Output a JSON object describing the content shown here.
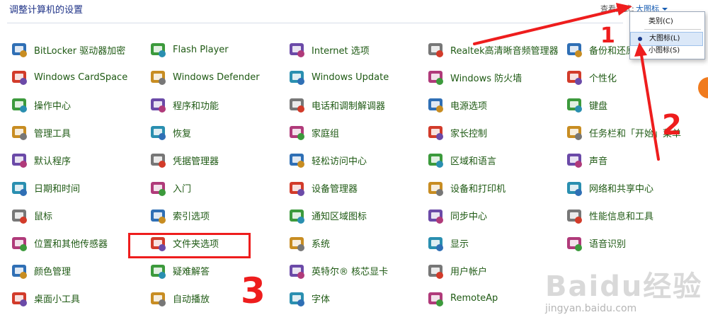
{
  "header": {
    "title": "调整计算机的设置",
    "view_by_label": "查看方式:",
    "view_by_value": "大图标"
  },
  "dropdown": {
    "options": [
      "类别(C)",
      "大图标(L)",
      "小图标(S)"
    ],
    "selected": "大图标(L)"
  },
  "items": [
    {
      "label": "BitLocker 驱动器加密",
      "icon": "bitlocker-icon"
    },
    {
      "label": "Windows CardSpace",
      "icon": "cardspace-icon"
    },
    {
      "label": "操作中心",
      "icon": "action-center-flag-icon"
    },
    {
      "label": "管理工具",
      "icon": "admin-tools-icon"
    },
    {
      "label": "默认程序",
      "icon": "default-programs-icon"
    },
    {
      "label": "日期和时间",
      "icon": "calendar-clock-icon"
    },
    {
      "label": "鼠标",
      "icon": "mouse-icon"
    },
    {
      "label": "位置和其他传感器",
      "icon": "location-sensor-icon"
    },
    {
      "label": "颜色管理",
      "icon": "color-management-icon"
    },
    {
      "label": "桌面小工具",
      "icon": "desktop-gadgets-icon"
    },
    {
      "label": "Flash Player",
      "icon": "flash-player-icon"
    },
    {
      "label": "Windows Defender",
      "icon": "windows-defender-icon"
    },
    {
      "label": "程序和功能",
      "icon": "programs-features-icon"
    },
    {
      "label": "恢复",
      "icon": "recovery-icon"
    },
    {
      "label": "凭据管理器",
      "icon": "credential-manager-icon"
    },
    {
      "label": "入门",
      "icon": "getting-started-icon"
    },
    {
      "label": "索引选项",
      "icon": "indexing-options-icon"
    },
    {
      "label": "文件夹选项",
      "icon": "folder-options-icon"
    },
    {
      "label": "疑难解答",
      "icon": "troubleshooting-icon"
    },
    {
      "label": "自动播放",
      "icon": "autoplay-icon"
    },
    {
      "label": "Internet 选项",
      "icon": "internet-options-icon"
    },
    {
      "label": "Windows Update",
      "icon": "windows-update-icon"
    },
    {
      "label": "电话和调制解调器",
      "icon": "phone-modem-icon"
    },
    {
      "label": "家庭组",
      "icon": "homegroup-icon"
    },
    {
      "label": "轻松访问中心",
      "icon": "ease-of-access-icon"
    },
    {
      "label": "设备管理器",
      "icon": "device-manager-icon"
    },
    {
      "label": "通知区域图标",
      "icon": "notification-area-icon"
    },
    {
      "label": "系统",
      "icon": "system-icon"
    },
    {
      "label": "英特尔® 核芯显卡",
      "icon": "intel-graphics-icon"
    },
    {
      "label": "字体",
      "icon": "fonts-icon"
    },
    {
      "label": "Realtek高清晰音频管理器",
      "icon": "realtek-audio-icon"
    },
    {
      "label": "Windows 防火墙",
      "icon": "firewall-icon"
    },
    {
      "label": "电源选项",
      "icon": "power-options-icon"
    },
    {
      "label": "家长控制",
      "icon": "parental-controls-icon"
    },
    {
      "label": "区域和语言",
      "icon": "region-language-icon"
    },
    {
      "label": "设备和打印机",
      "icon": "devices-printers-icon"
    },
    {
      "label": "同步中心",
      "icon": "sync-center-icon"
    },
    {
      "label": "显示",
      "icon": "display-icon"
    },
    {
      "label": "用户帐户",
      "icon": "user-accounts-icon"
    },
    {
      "label": "RemoteAp",
      "icon": "remoteapp-icon"
    },
    {
      "label": "备份和还原",
      "icon": "backup-restore-icon"
    },
    {
      "label": "个性化",
      "icon": "personalization-icon"
    },
    {
      "label": "键盘",
      "icon": "keyboard-icon"
    },
    {
      "label": "任务栏和「开始」菜单",
      "icon": "taskbar-start-icon"
    },
    {
      "label": "声音",
      "icon": "sound-icon"
    },
    {
      "label": "网络和共享中心",
      "icon": "network-sharing-icon"
    },
    {
      "label": "性能信息和工具",
      "icon": "performance-tools-icon"
    },
    {
      "label": "语音识别",
      "icon": "speech-recognition-icon"
    }
  ],
  "annotations": {
    "marks": [
      "1",
      "2",
      "3"
    ]
  },
  "watermark": {
    "logo": "Baidu经验",
    "url": "jingyan.baidu.com"
  }
}
